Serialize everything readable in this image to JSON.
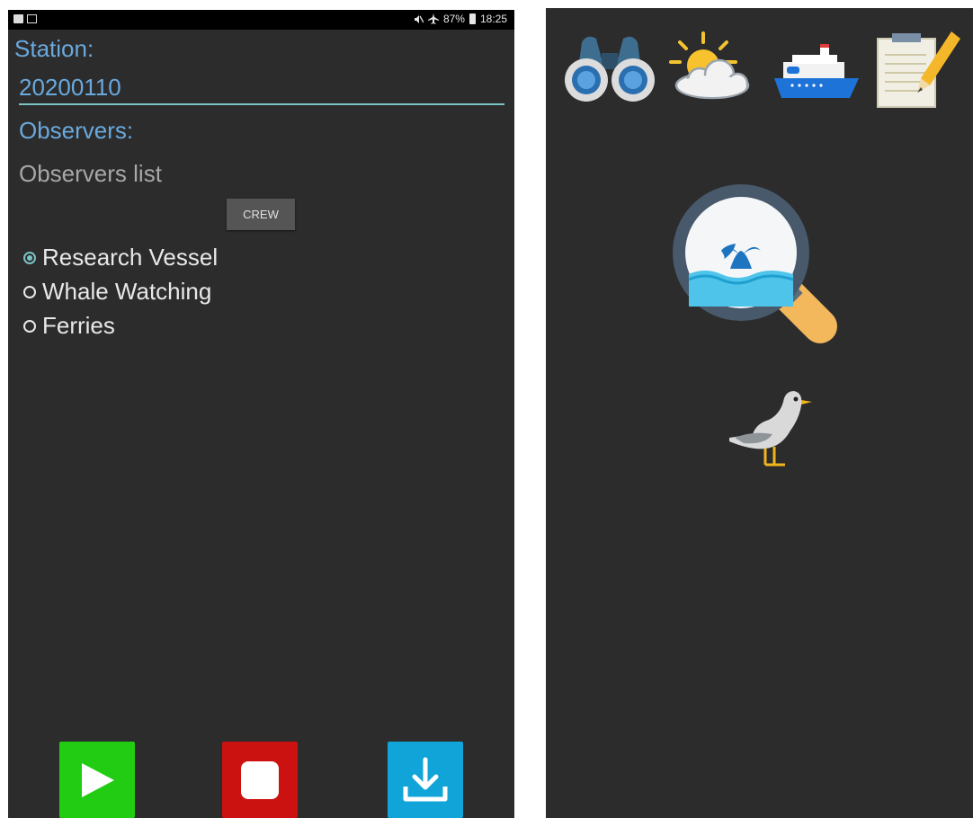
{
  "status_bar": {
    "battery": "87%",
    "time": "18:25",
    "left_icons": [
      "image-icon",
      "sim-icon"
    ],
    "right_icons": [
      "mute-icon",
      "airplane-icon",
      "battery-icon"
    ]
  },
  "form": {
    "station_label": "Station:",
    "station_value": "20200110",
    "observers_label": "Observers:",
    "observers_placeholder": "Observers list",
    "crew_button": "CREW",
    "platform_options": [
      {
        "label": "Research Vessel",
        "selected": true
      },
      {
        "label": "Whale Watching",
        "selected": false
      },
      {
        "label": "Ferries",
        "selected": false
      }
    ]
  },
  "actions": {
    "buttons": [
      {
        "name": "play",
        "icon": "play-icon",
        "color": "#22cc12"
      },
      {
        "name": "stop",
        "icon": "stop-icon",
        "color": "#cc1111"
      },
      {
        "name": "download",
        "icon": "download-icon",
        "color": "#11a4d8"
      }
    ]
  },
  "right_screen": {
    "toolbar_icons": [
      "binoculars-icon",
      "weather-icon",
      "ship-icon",
      "notes-icon"
    ],
    "center_icons": [
      "whale-search-icon",
      "seagull-icon"
    ],
    "colors": {
      "background": "#2c2c2c",
      "accent": "#6aa9dd",
      "underline": "#79c3c2"
    }
  }
}
